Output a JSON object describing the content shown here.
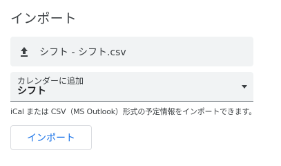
{
  "section": {
    "title": "インポート"
  },
  "file_picker": {
    "file_name": "シフト - シフト.csv",
    "icon": "upload-icon"
  },
  "calendar_select": {
    "label": "カレンダーに追加",
    "selected": "シフト"
  },
  "help_text": "iCal または CSV（MS Outlook）形式の予定情報をインポートできます。",
  "import_button": {
    "label": "インポート"
  },
  "colors": {
    "accent": "#1a73e8",
    "field_bg": "#f1f3f4",
    "text": "#3c4043"
  }
}
